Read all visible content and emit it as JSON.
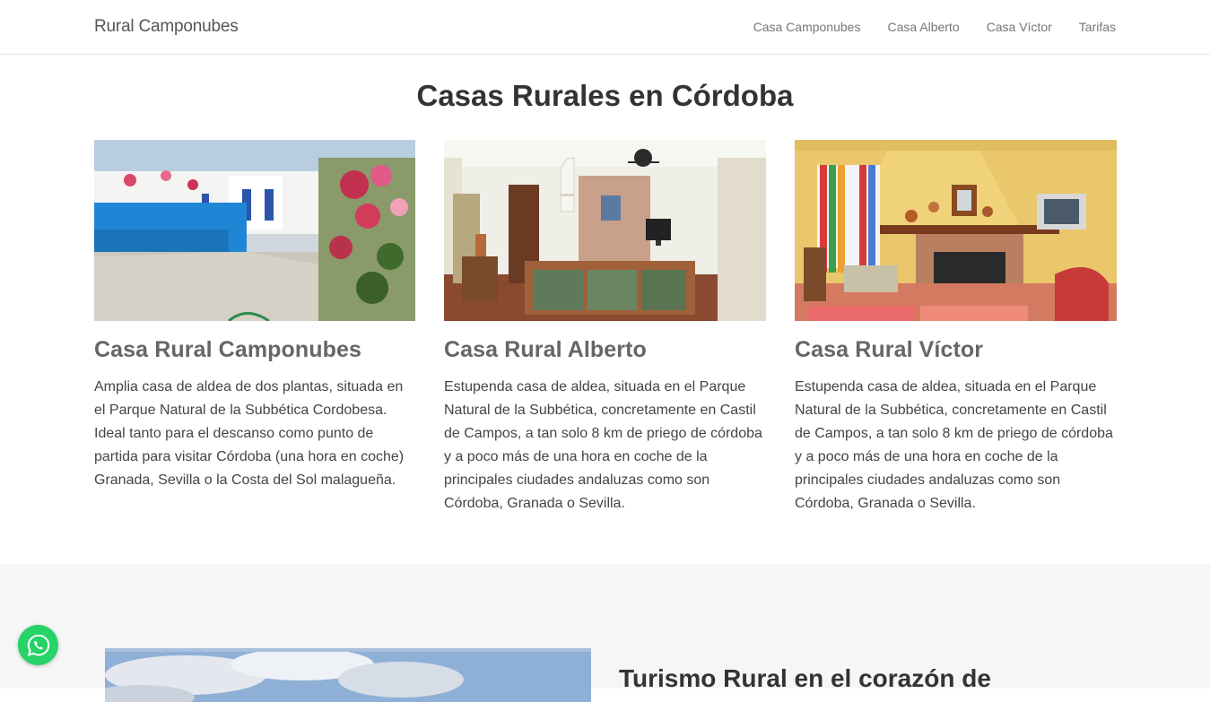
{
  "navbar": {
    "brand": "Rural Camponubes",
    "links": [
      {
        "label": "Casa Camponubes"
      },
      {
        "label": "Casa Alberto"
      },
      {
        "label": "Casa Víctor"
      },
      {
        "label": "Tarifas"
      }
    ]
  },
  "main": {
    "title": "Casas Rurales en Córdoba",
    "cards": [
      {
        "title": "Casa Rural Camponubes",
        "text": "Amplia casa de aldea de dos plantas, situada en el Parque Natural de la Subbética Cordobesa. Ideal tanto para el descanso como punto de partida para visitar Córdoba (una hora en coche) Granada, Sevilla o la Costa del Sol malagueña.",
        "image_icon": "pool-patio-photo"
      },
      {
        "title": "Casa Rural Alberto",
        "text": "Estupenda casa de aldea, situada en el Parque Natural de la Subbética, concretamente en Castil de Campos, a tan solo 8 km de priego de córdoba y a poco más de una hora en coche de la principales ciudades andaluzas como son Córdoba, Granada o Sevilla.",
        "image_icon": "living-room-photo"
      },
      {
        "title": "Casa Rural Víctor",
        "text": "Estupenda casa de aldea, situada en el Parque Natural de la Subbética, concretamente en Castil de Campos, a tan solo 8 km de priego de córdoba y a poco más de una hora en coche de la principales ciudades andaluzas como son Córdoba, Granada o Sevilla.",
        "image_icon": "fireplace-room-photo"
      }
    ]
  },
  "lower": {
    "title": "Turismo Rural en el corazón de"
  },
  "whatsapp": {
    "icon": "whatsapp-icon",
    "color": "#25d366"
  }
}
